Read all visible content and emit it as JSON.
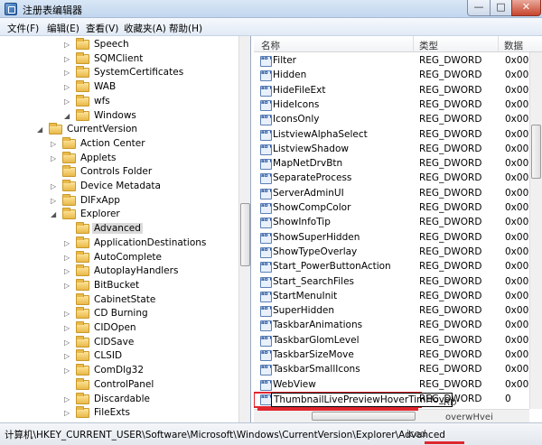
{
  "window": {
    "title": "注册表编辑器",
    "controls": {
      "minimize": "—",
      "maximize": "□",
      "close": "✕"
    }
  },
  "menu": [
    "文件(F)",
    "编辑(E)",
    "查看(V)",
    "收藏夹(A)",
    "帮助(H)"
  ],
  "tree": {
    "items": [
      {
        "label": "Speech",
        "toggle": "▷"
      },
      {
        "label": "SQMClient",
        "toggle": "▷"
      },
      {
        "label": "SystemCertificates",
        "toggle": "▷"
      },
      {
        "label": "WAB",
        "toggle": "▷"
      },
      {
        "label": "wfs",
        "toggle": "▷"
      },
      {
        "label": "Windows",
        "toggle": "◢"
      },
      {
        "label": "CurrentVersion",
        "toggle": "◢"
      },
      {
        "label": "Action Center",
        "toggle": "▷"
      },
      {
        "label": "Applets",
        "toggle": "▷"
      },
      {
        "label": "Controls Folder",
        "toggle": ""
      },
      {
        "label": "Device Metadata",
        "toggle": "▷"
      },
      {
        "label": "DIFxApp",
        "toggle": "▷"
      },
      {
        "label": "Explorer",
        "toggle": "◢"
      },
      {
        "label": "Advanced",
        "toggle": ""
      },
      {
        "label": "ApplicationDestinations",
        "toggle": "▷"
      },
      {
        "label": "AutoComplete",
        "toggle": "▷"
      },
      {
        "label": "AutoplayHandlers",
        "toggle": "▷"
      },
      {
        "label": "BitBucket",
        "toggle": "▷"
      },
      {
        "label": "CabinetState",
        "toggle": ""
      },
      {
        "label": "CD Burning",
        "toggle": "▷"
      },
      {
        "label": "CIDOpen",
        "toggle": "▷"
      },
      {
        "label": "CIDSave",
        "toggle": "▷"
      },
      {
        "label": "CLSID",
        "toggle": "▷"
      },
      {
        "label": "ComDlg32",
        "toggle": "▷"
      },
      {
        "label": "ControlPanel",
        "toggle": ""
      },
      {
        "label": "Discardable",
        "toggle": "▷"
      },
      {
        "label": "FileExts",
        "toggle": "▷"
      }
    ],
    "selected": "Advanced"
  },
  "list": {
    "headers": {
      "name": "名称",
      "type": "类型",
      "data": "数据"
    },
    "icon_text": "ab\n01",
    "rows": [
      {
        "name": "Filter",
        "type": "REG_DWORD",
        "data": "0x00"
      },
      {
        "name": "Hidden",
        "type": "REG_DWORD",
        "data": "0x00"
      },
      {
        "name": "HideFileExt",
        "type": "REG_DWORD",
        "data": "0x00"
      },
      {
        "name": "HideIcons",
        "type": "REG_DWORD",
        "data": "0x00"
      },
      {
        "name": "IconsOnly",
        "type": "REG_DWORD",
        "data": "0x00"
      },
      {
        "name": "ListviewAlphaSelect",
        "type": "REG_DWORD",
        "data": "0x00"
      },
      {
        "name": "ListviewShadow",
        "type": "REG_DWORD",
        "data": "0x00"
      },
      {
        "name": "MapNetDrvBtn",
        "type": "REG_DWORD",
        "data": "0x00"
      },
      {
        "name": "SeparateProcess",
        "type": "REG_DWORD",
        "data": "0x00"
      },
      {
        "name": "ServerAdminUI",
        "type": "REG_DWORD",
        "data": "0x00"
      },
      {
        "name": "ShowCompColor",
        "type": "REG_DWORD",
        "data": "0x00"
      },
      {
        "name": "ShowInfoTip",
        "type": "REG_DWORD",
        "data": "0x00"
      },
      {
        "name": "ShowSuperHidden",
        "type": "REG_DWORD",
        "data": "0x00"
      },
      {
        "name": "ShowTypeOverlay",
        "type": "REG_DWORD",
        "data": "0x00"
      },
      {
        "name": "Start_PowerButtonAction",
        "type": "REG_DWORD",
        "data": "0x00"
      },
      {
        "name": "Start_SearchFiles",
        "type": "REG_DWORD",
        "data": "0x00"
      },
      {
        "name": "StartMenuInit",
        "type": "REG_DWORD",
        "data": "0x00"
      },
      {
        "name": "SuperHidden",
        "type": "REG_DWORD",
        "data": "0x00"
      },
      {
        "name": "TaskbarAnimations",
        "type": "REG_DWORD",
        "data": "0x00"
      },
      {
        "name": "TaskbarGlomLevel",
        "type": "REG_DWORD",
        "data": "0x00"
      },
      {
        "name": "TaskbarSizeMove",
        "type": "REG_DWORD",
        "data": "0x00"
      },
      {
        "name": "TaskbarSmallIcons",
        "type": "REG_DWORD",
        "data": "0x00"
      },
      {
        "name": "WebView",
        "type": "REG_DWORD",
        "data": "0x00"
      },
      {
        "name": "ThumbnailLivePreviewHoverTimHove",
        "type": "REG_DWORD",
        "data": "0"
      }
    ],
    "editing_value": "ThumbnailLivePreviewHoverTimHove",
    "ghost_text": {
      "rd": "RD",
      "overw": "overwHvei"
    }
  },
  "status": {
    "path": "计算机\\HKEY_CURRENT_USER\\Software\\Microsoft\\Windows\\CurrentVersion\\Explorer\\Advanced",
    "ghost": "iced"
  },
  "colors": {
    "highlight": "#e0262e",
    "selection": "#dadada",
    "titlebar": "#c2d6ee"
  }
}
